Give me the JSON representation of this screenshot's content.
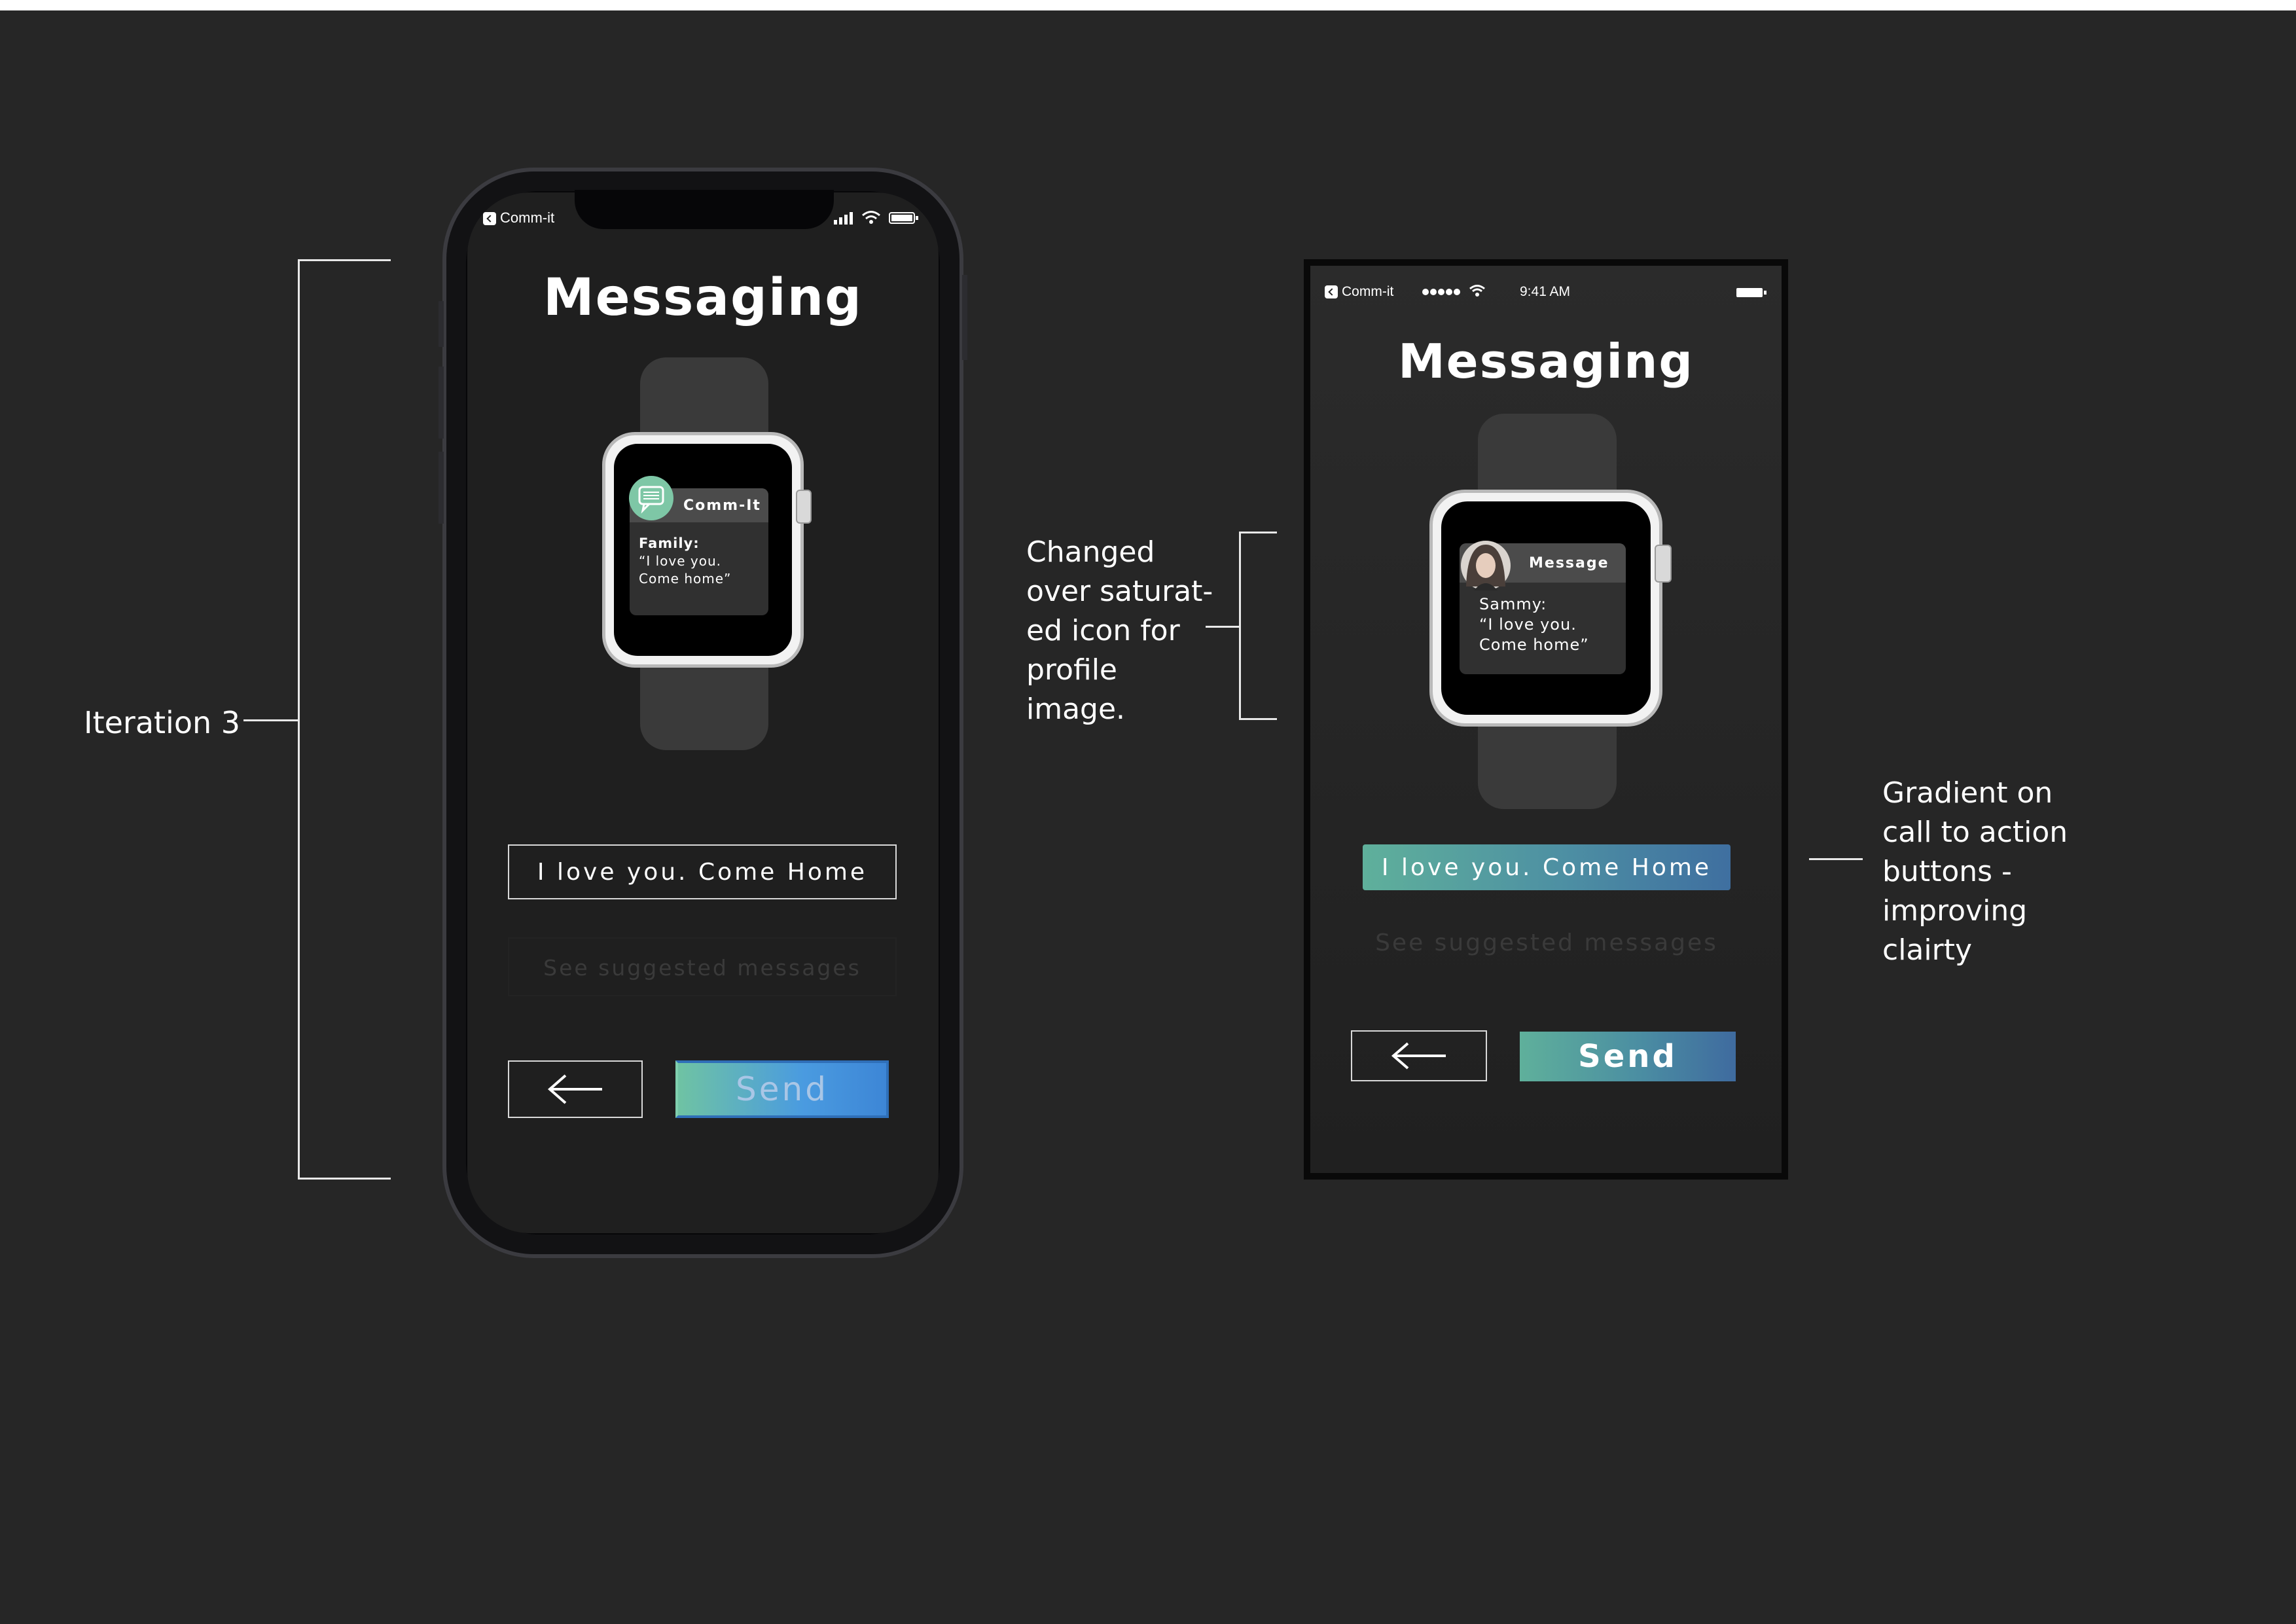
{
  "annotations": {
    "iteration_label": "Iteration 3",
    "icon_change": [
      "Changed",
      "over saturat-",
      "ed icon for",
      "profile",
      "image."
    ],
    "gradient_note": [
      "Gradient on",
      "call to action",
      "buttons -",
      "improving",
      "clairty"
    ]
  },
  "phone_v1": {
    "status_app": "Comm-it",
    "title": "Messaging",
    "watch_card": {
      "header": "Comm-It",
      "sender": "Family:",
      "body": "“I love you.\nCome home”",
      "icon": "chat-bubble-icon"
    },
    "message_button": "I love you. Come Home",
    "suggest_link": "See suggested messages",
    "back_icon": "arrow-left-icon",
    "send_label": "Send"
  },
  "phone_v2": {
    "status_app": "Comm-it",
    "status_time": "9:41 AM",
    "title": "Messaging",
    "watch_card": {
      "header": "Message",
      "body": "Sammy:\n“I love you.\nCome home”",
      "avatar": "profile-photo"
    },
    "message_button": "I love you. Come Home",
    "suggest_link": "See suggested messages",
    "back_icon": "arrow-left-icon",
    "send_label": "Send"
  },
  "colors": {
    "background": "#262626",
    "gradient_v1": [
      "#6fc3a3",
      "#3d86d6"
    ],
    "gradient_v2": [
      "#5fb09b",
      "#3f6fa0"
    ],
    "chat_icon_bg": "#7ec7a6"
  }
}
